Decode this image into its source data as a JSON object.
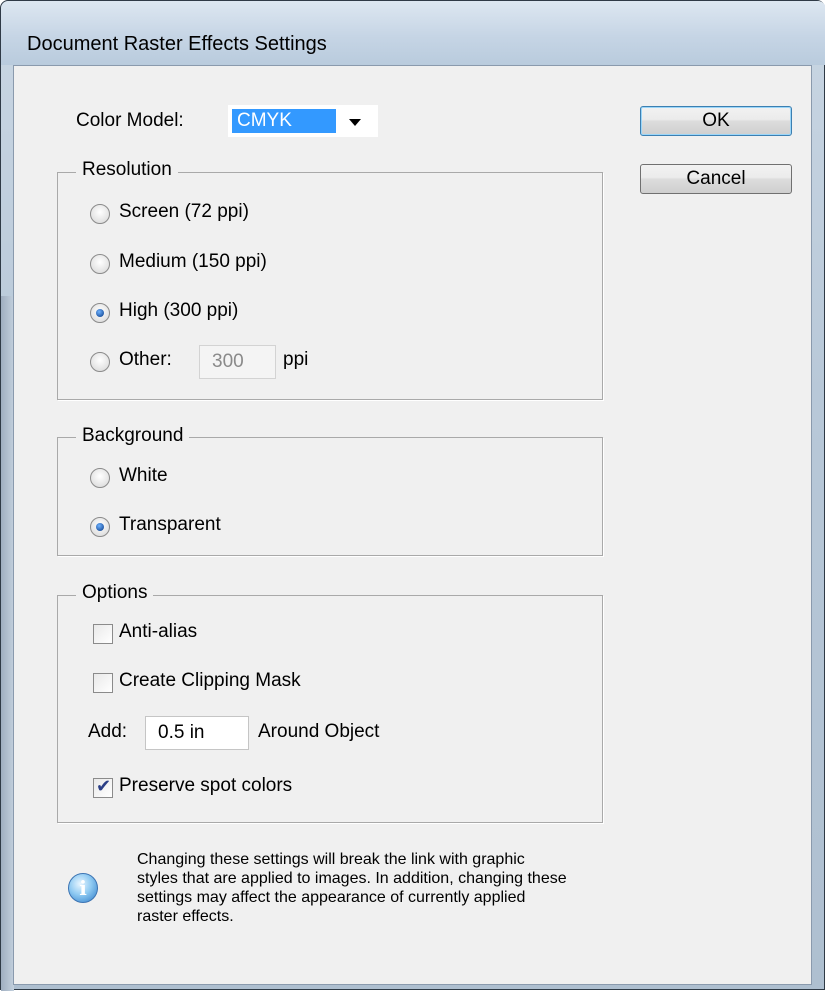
{
  "window": {
    "title": "Document Raster Effects Settings"
  },
  "color_model": {
    "label": "Color Model:",
    "value": "CMYK"
  },
  "buttons": {
    "ok": "OK",
    "cancel": "Cancel"
  },
  "resolution": {
    "title": "Resolution",
    "options": [
      {
        "label": "Screen (72 ppi)",
        "checked": false
      },
      {
        "label": "Medium (150 ppi)",
        "checked": false
      },
      {
        "label": "High (300 ppi)",
        "checked": true
      },
      {
        "label": "Other:",
        "checked": false
      }
    ],
    "other_value": "300",
    "other_unit": "ppi"
  },
  "background": {
    "title": "Background",
    "options": [
      {
        "label": "White",
        "checked": false
      },
      {
        "label": "Transparent",
        "checked": true
      }
    ]
  },
  "options": {
    "title": "Options",
    "anti_alias": {
      "label": "Anti-alias",
      "checked": false
    },
    "clipping_mask": {
      "label": "Create Clipping Mask",
      "checked": false
    },
    "add_label": "Add:",
    "add_value": "0.5 in",
    "around_label": "Around Object",
    "preserve_spot": {
      "label": "Preserve spot colors",
      "checked": true
    }
  },
  "info": {
    "icon": "info-icon",
    "text": "Changing these settings will break the link with graphic styles that are applied to images. In addition, changing these settings may affect the appearance of currently applied raster effects."
  }
}
